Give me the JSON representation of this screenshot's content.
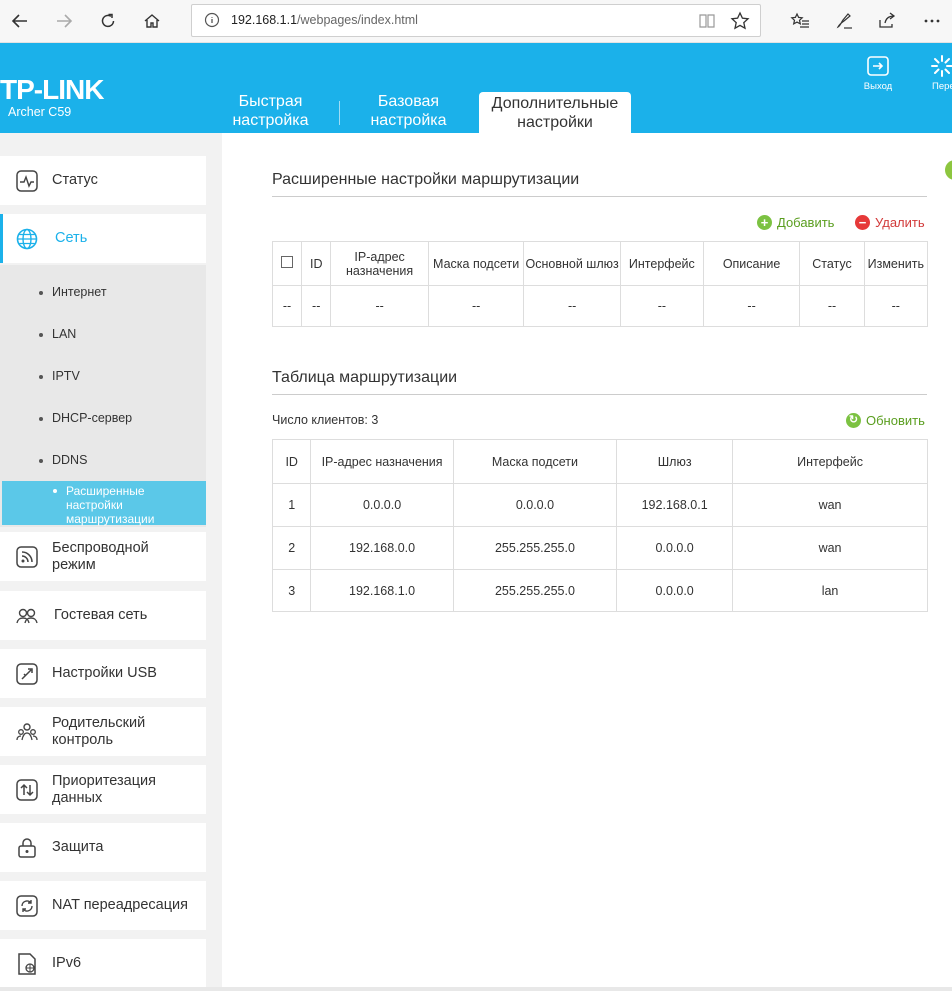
{
  "browser": {
    "url_host": "192.168.1.1",
    "url_path": "/webpages/index.html"
  },
  "header": {
    "logo": "TP-LINK",
    "model": "Archer C59",
    "tabs": [
      {
        "line1": "Быстрая",
        "line2": "настройка"
      },
      {
        "line1": "Базовая",
        "line2": "настройка"
      },
      {
        "line1": "Дополнительные",
        "line2": "настройки"
      }
    ],
    "logout": "Выход",
    "reboot": "Перезагрузка"
  },
  "sidebar": {
    "items": [
      {
        "label": "Статус"
      },
      {
        "label": "Сеть"
      },
      {
        "label": "Беспроводной режим"
      },
      {
        "label": "Гостевая сеть"
      },
      {
        "label": "Настройки USB"
      },
      {
        "label": "Родительский контроль"
      },
      {
        "label": "Приоритезация данных"
      },
      {
        "label": "Защита"
      },
      {
        "label": "NAT переадресация"
      },
      {
        "label": "IPv6"
      }
    ],
    "subitems": [
      {
        "label": "Интернет"
      },
      {
        "label": "LAN"
      },
      {
        "label": "IPTV"
      },
      {
        "label": "DHCP-сервер"
      },
      {
        "label": "DDNS"
      },
      {
        "label": "Расширенные настройки маршрутизации"
      }
    ]
  },
  "advanced": {
    "title": "Расширенные настройки маршрутизации",
    "add": "Добавить",
    "delete": "Удалить",
    "headers": [
      "ID",
      "IP-адрес назначения",
      "Маска подсети",
      "Основной шлюз",
      "Интерфейс",
      "Описание",
      "Статус",
      "Изменить"
    ],
    "empty": "--"
  },
  "routing": {
    "title": "Таблица маршрутизации",
    "clients_label": "Число клиентов:",
    "clients_count": "3",
    "refresh": "Обновить",
    "headers": [
      "ID",
      "IP-адрес назначения",
      "Маска подсети",
      "Шлюз",
      "Интерфейс"
    ],
    "rows": [
      [
        "1",
        "0.0.0.0",
        "0.0.0.0",
        "192.168.0.1",
        "wan"
      ],
      [
        "2",
        "192.168.0.0",
        "255.255.255.0",
        "0.0.0.0",
        "wan"
      ],
      [
        "3",
        "192.168.1.0",
        "255.255.255.0",
        "0.0.0.0",
        "lan"
      ]
    ]
  }
}
